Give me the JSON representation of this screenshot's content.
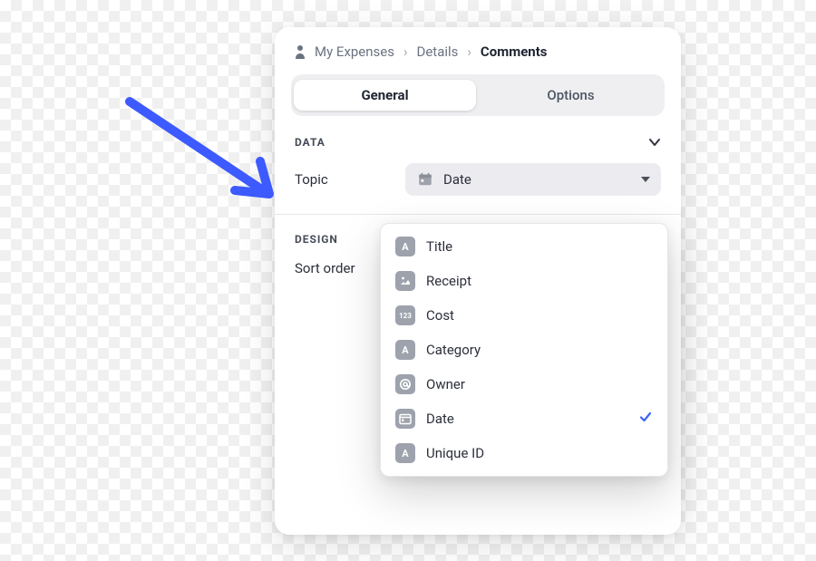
{
  "breadcrumb": {
    "items": [
      "My Expenses",
      "Details",
      "Comments"
    ],
    "current_index": 2
  },
  "tabs": {
    "items": [
      "General",
      "Options"
    ],
    "active_index": 0
  },
  "sections": {
    "data": {
      "title": "DATA"
    },
    "design": {
      "title": "DESIGN"
    }
  },
  "fields": {
    "topic": {
      "label": "Topic",
      "selected": "Date",
      "selected_icon": "calendar"
    },
    "sort_order": {
      "label": "Sort order"
    }
  },
  "dropdown": {
    "options": [
      {
        "icon": "text",
        "label": "Title"
      },
      {
        "icon": "image",
        "label": "Receipt"
      },
      {
        "icon": "number",
        "label": "Cost"
      },
      {
        "icon": "text",
        "label": "Category"
      },
      {
        "icon": "at",
        "label": "Owner"
      },
      {
        "icon": "calendar",
        "label": "Date",
        "selected": true
      },
      {
        "icon": "text",
        "label": "Unique ID"
      }
    ]
  },
  "icons": {
    "text_glyph": "A",
    "number_glyph": "123"
  },
  "colors": {
    "arrow": "#3d5afe",
    "check": "#3b62ff",
    "icon_bg": "#9ea2ad"
  }
}
